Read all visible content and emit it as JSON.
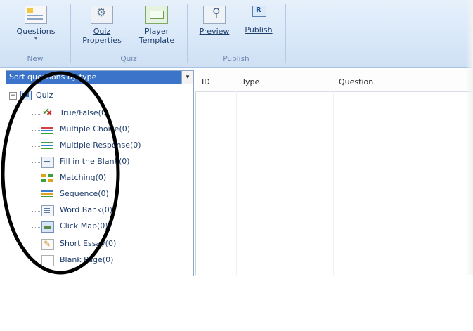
{
  "ribbon": {
    "groups": {
      "new": {
        "label": "New",
        "questions_button": {
          "label": "Questions",
          "caret": "▾"
        }
      },
      "quiz": {
        "label": "Quiz",
        "quiz_properties": {
          "line1": "Quiz",
          "line2": "Properties"
        },
        "player_template": {
          "line1": "Player",
          "line2": "Template"
        }
      },
      "publish": {
        "label": "Publish",
        "preview": {
          "label": "Preview"
        },
        "publish": {
          "label": "Publish"
        }
      }
    }
  },
  "left_panel": {
    "sort_dropdown": {
      "value": "Sort questions by type",
      "arrow": "▾"
    },
    "tree": {
      "root": {
        "label": "Quiz",
        "expander": "−"
      },
      "items": [
        {
          "label": "True/False(0)",
          "icon": "true-false-icon"
        },
        {
          "label": "Multiple Choice(0)",
          "icon": "multiple-choice-icon"
        },
        {
          "label": "Multiple Response(0)",
          "icon": "multiple-response-icon"
        },
        {
          "label": "Fill in the Blank(0)",
          "icon": "fill-in-blank-icon"
        },
        {
          "label": "Matching(0)",
          "icon": "matching-icon"
        },
        {
          "label": "Sequence(0)",
          "icon": "sequence-icon"
        },
        {
          "label": "Word Bank(0)",
          "icon": "word-bank-icon"
        },
        {
          "label": "Click Map(0)",
          "icon": "click-map-icon"
        },
        {
          "label": "Short Essay(0)",
          "icon": "short-essay-icon"
        },
        {
          "label": "Blank Page(0)",
          "icon": "blank-page-icon"
        }
      ]
    }
  },
  "grid": {
    "columns": [
      "ID",
      "Type",
      "Question"
    ]
  },
  "colors": {
    "ribbon_bg": "#d8e7f8",
    "selection_blue": "#3b74c9",
    "text_blue": "#1e3d6b",
    "annotation": "#000000"
  }
}
